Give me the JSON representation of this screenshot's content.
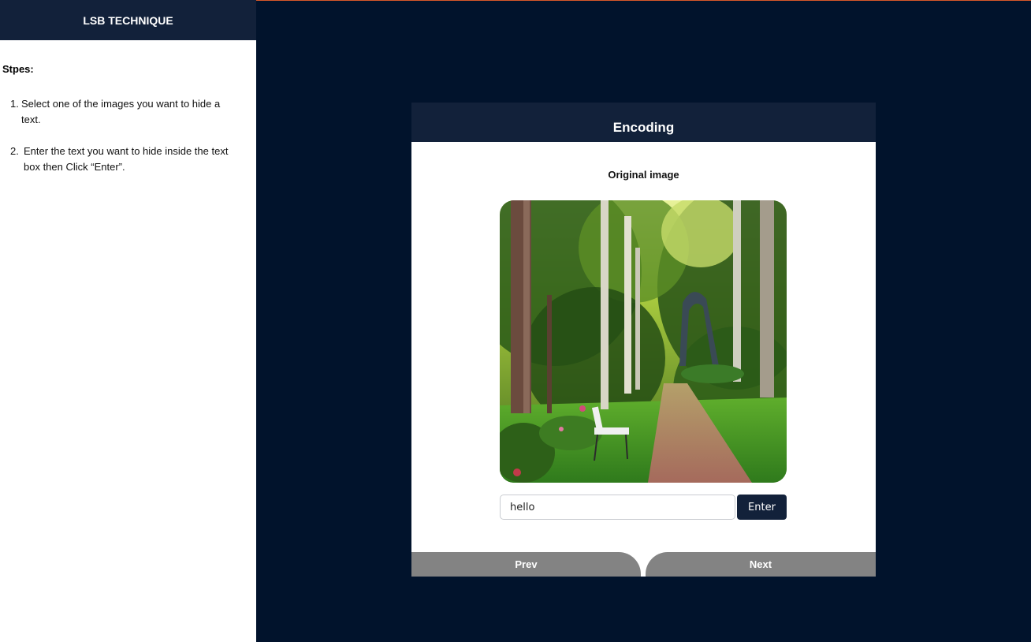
{
  "sidebar": {
    "title": "LSB TECHNIQUE",
    "steps_heading": "Stpes:",
    "steps": [
      {
        "num": "1.",
        "text": "Select one of the images you want to hide a text."
      },
      {
        "num": "2.",
        "text": "Enter the text you want to hide inside the text box then Click “Enter”."
      }
    ]
  },
  "card": {
    "title": "Encoding",
    "image_label": "Original image",
    "input_value": "hello",
    "enter_label": "Enter",
    "prev_label": "Prev",
    "next_label": "Next"
  },
  "colors": {
    "page_background": "#01132c",
    "header_background": "#12213a",
    "nav_button": "#838383",
    "accent_line": "#d9582a"
  }
}
